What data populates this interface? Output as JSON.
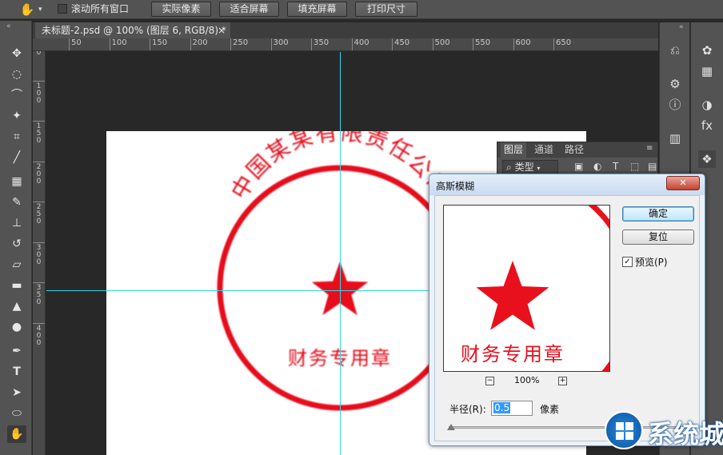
{
  "options_bar": {
    "scroll_all_label": "滚动所有窗口",
    "btn_actual_pixels": "实际像素",
    "btn_fit_screen": "适合屏幕",
    "btn_fill_screen": "填充屏幕",
    "btn_print_size": "打印尺寸"
  },
  "document": {
    "tab_title": "未标题-2.psd @ 100% (图层 6, RGB/8) *",
    "tab_close": "×"
  },
  "ruler": {
    "h_labels": [
      "50",
      "100",
      "150",
      "200",
      "250",
      "300",
      "350",
      "400",
      "450",
      "500",
      "550",
      "600",
      "650"
    ],
    "v_labels": [
      "5\n0",
      "1\n0\n0",
      "1\n5\n0",
      "2\n0\n0",
      "2\n5\n0",
      "3\n0\n0",
      "3\n5\n0",
      "4\n0\n0"
    ]
  },
  "seal": {
    "top_text": "中国某某有限责任公司",
    "bottom_text": "财务专用章",
    "color": "#e8101c"
  },
  "layers_panel": {
    "tab_layers": "图层",
    "tab_channels": "通道",
    "tab_paths": "路径",
    "filter_label": "类型"
  },
  "dialog": {
    "title": "高斯模糊",
    "ok_label": "确定",
    "reset_label": "复位",
    "preview_label": "预览(P)",
    "zoom_level": "100%",
    "zoom_out": "−",
    "zoom_in": "+",
    "radius_label": "半径(R):",
    "radius_value": "0.5",
    "radius_unit": "像素",
    "close_symbol": "✕"
  },
  "watermark": {
    "text": "系统城"
  }
}
